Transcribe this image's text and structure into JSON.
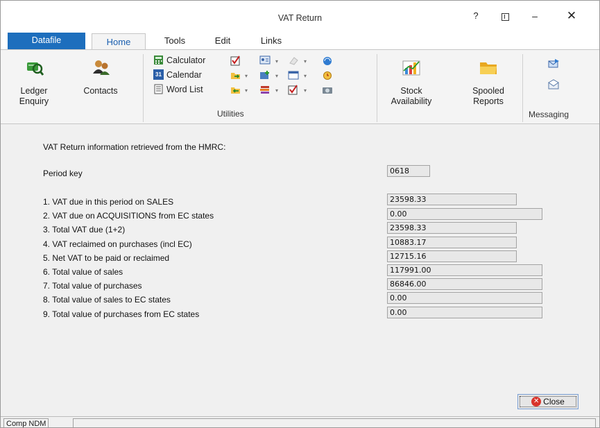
{
  "window": {
    "title": "VAT Return",
    "help_glyph": "?",
    "minimize_glyph": "–",
    "close_glyph": "✕"
  },
  "tabs": {
    "datafile": "Datafile",
    "home": "Home",
    "tools": "Tools",
    "edit": "Edit",
    "links": "Links"
  },
  "ribbon": {
    "ledger_enquiry": [
      "Ledger",
      "Enquiry"
    ],
    "contacts": "Contacts",
    "calculator": "Calculator",
    "calendar": "Calendar",
    "word_list": "Word List",
    "utilities_label": "Utilities",
    "stock_availability": [
      "Stock",
      "Availability"
    ],
    "spooled_reports": [
      "Spooled",
      "Reports"
    ],
    "messaging_label": "Messaging",
    "calendar_icon_text": "31"
  },
  "content": {
    "info": "VAT Return information retrieved from the HMRC:",
    "period_key_label": "Period key",
    "period_key_value": "0618",
    "rows": [
      {
        "label": "1. VAT due in this period on SALES",
        "value": "23598.33"
      },
      {
        "label": "2. VAT due on ACQUISITIONS from EC states",
        "value": "0.00"
      },
      {
        "label": "3. Total VAT due (1+2)",
        "value": "23598.33"
      },
      {
        "label": "4. VAT reclaimed on purchases (incl EC)",
        "value": "10883.17"
      },
      {
        "label": "5. Net VAT to be paid or reclaimed",
        "value": "12715.16"
      },
      {
        "label": "6. Total value of sales",
        "value": "117991.00"
      },
      {
        "label": "7. Total value of purchases",
        "value": "86846.00"
      },
      {
        "label": "8. Total value of sales to EC states",
        "value": "0.00"
      },
      {
        "label": "9. Total value of purchases from EC states",
        "value": "0.00"
      }
    ],
    "close_button": "Close"
  },
  "status": {
    "company": "Comp NDM"
  },
  "icons": {
    "ledger_enquiry": "ledger-magnifier-icon",
    "contacts": "contacts-people-icon",
    "calculator": "calculator-icon",
    "calendar": "calendar-icon",
    "word_list": "word-list-icon",
    "stock": "stock-chart-icon",
    "spooled": "folder-icon",
    "close": "close-circle-icon"
  }
}
